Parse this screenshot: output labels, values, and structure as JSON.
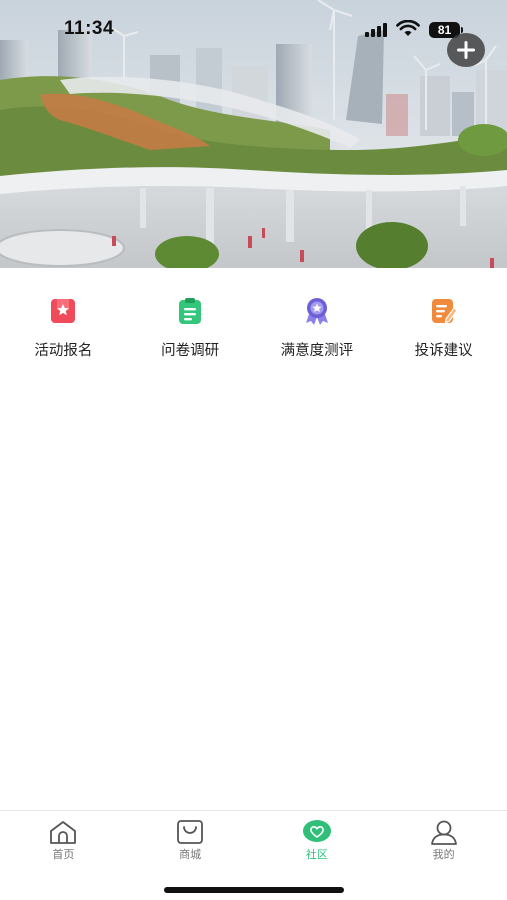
{
  "status_bar": {
    "time": "11:34",
    "battery": "81"
  },
  "header": {
    "add_icon": "plus-icon"
  },
  "services": [
    {
      "label": "活动报名",
      "icon": "bookmark-star-icon",
      "color": "#ef4b5a"
    },
    {
      "label": "问卷调研",
      "icon": "clipboard-icon",
      "color": "#34c77b"
    },
    {
      "label": "满意度测评",
      "icon": "award-medal-icon",
      "color": "#6d5fd6"
    },
    {
      "label": "投诉建议",
      "icon": "edit-note-icon",
      "color": "#f08a3c"
    }
  ],
  "tab_bar": {
    "active_color": "#2fbf78",
    "tabs": [
      {
        "label": "首页",
        "icon": "home-icon"
      },
      {
        "label": "商城",
        "icon": "shopping-bag-icon"
      },
      {
        "label": "社区",
        "icon": "heart-chat-icon",
        "active": true
      },
      {
        "label": "我的",
        "icon": "user-icon"
      }
    ]
  }
}
